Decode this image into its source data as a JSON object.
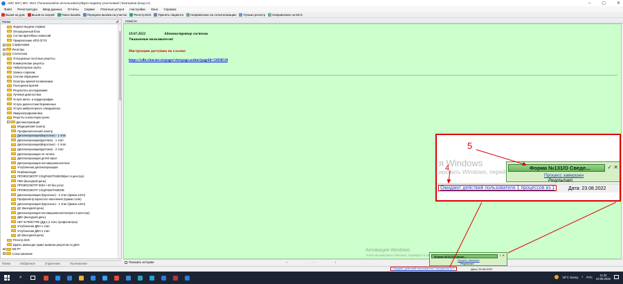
{
  "window": {
    "title": "АИС МО | МО: 2621 (Талнахская/не использовать)/Врач-педиатр участковый | Екатерина (вход от)",
    "controls": [
      "–",
      "▢",
      "✕"
    ]
  },
  "menu": [
    "Файл",
    "Регистратура",
    "Ввод данных",
    "Отчеты",
    "Сервис",
    "Платные услуги",
    "Настройки",
    "Окно",
    "Справка"
  ],
  "toolbar": [
    {
      "label": "Вызов на дом",
      "icon": "house-icon",
      "color": "#d33"
    },
    {
      "label": "Вызов из скорой",
      "icon": "ambulance-icon",
      "color": "#c33"
    },
    {
      "label": "Поиск вызова",
      "icon": "search-icon",
      "color": "#3a7"
    },
    {
      "label": "Передача вызова на участок",
      "icon": "transfer-icon",
      "color": "#58c"
    },
    {
      "label": "Регистр БСК",
      "icon": "register-icon",
      "color": "#2a8"
    },
    {
      "label": "Принять пациента",
      "icon": "patient-icon",
      "color": "#68a"
    },
    {
      "label": "Направление на госпитализацию",
      "icon": "referral-icon",
      "color": "#7a7"
    },
    {
      "label": "Пульмо регистр",
      "icon": "lungs-icon",
      "color": "#69c"
    },
    {
      "label": "Направление на МСЭ",
      "icon": "mse-icon",
      "color": "#7a9"
    }
  ],
  "left_panel": {
    "header": "Папки",
    "pin": "📌",
    "tree": [
      {
        "label": "Журнал выдачи справок",
        "depth": 2
      },
      {
        "label": "Операционный блок",
        "depth": 2
      },
      {
        "label": "Состав врачебных комиссий",
        "depth": 2
      },
      {
        "label": "Прикрепление ИПЗ ОГУЗ",
        "depth": 2
      },
      {
        "label": "Справочники",
        "depth": 1,
        "toggle": "+"
      },
      {
        "label": "Регистры",
        "depth": 1,
        "toggle": "+"
      },
      {
        "label": "Статистика",
        "depth": 1,
        "toggle": "−"
      },
      {
        "label": "Отпущенные льготные рецепты",
        "depth": 2
      },
      {
        "label": "Коммерческие рецепты",
        "depth": 2
      },
      {
        "label": "Амбулаторные карты",
        "depth": 2
      },
      {
        "label": "Записи к врачам",
        "depth": 2
      },
      {
        "label": "Случаи обращения",
        "depth": 2
      },
      {
        "label": "Осмотры врачей поликлиники",
        "depth": 2
      },
      {
        "label": "Посещения врачей",
        "depth": 2
      },
      {
        "label": "Результаты исследования",
        "depth": 2
      },
      {
        "label": "Лучевая диагностика",
        "depth": 2
      },
      {
        "label": "Услуги автно- и кардиографии",
        "depth": 2
      },
      {
        "label": "Услуги диагностики беременных",
        "depth": 2
      },
      {
        "label": "Услуги амбулаторного гемодиализа",
        "depth": 2
      },
      {
        "label": "Иммунопрофилактика",
        "depth": 2
      },
      {
        "label": "Рецепты в молочную кухню",
        "depth": 2
      },
      {
        "label": "Диспансеризация",
        "depth": 2,
        "toggle": "−"
      },
      {
        "label": "Медицинский осмотр",
        "depth": 3
      },
      {
        "label": "Профилактический осмотр",
        "depth": 3
      },
      {
        "label": "Диспансеризация(взрослые) - 1 этап",
        "depth": 3,
        "selected": true
      },
      {
        "label": "Диспансеризация(детские) - 1 этап",
        "depth": 3
      },
      {
        "label": "Диспансеризация(взрослые) - 2 этап",
        "depth": 3
      },
      {
        "label": "Диспансеризация(детские) - 2 этап",
        "depth": 3
      },
      {
        "label": "Диспансеризация 14 летних",
        "depth": 3
      },
      {
        "label": "Диспансеризация детей сирот",
        "depth": 3
      },
      {
        "label": "Диспансеризация несовершеннолетних",
        "depth": 3
      },
      {
        "label": "Углубленная диспансеризация",
        "depth": 3
      },
      {
        "label": "Реабилитация",
        "depth": 3
      },
      {
        "label": "ПРОФОСМОТР СОЦРАБОТНИКОВ(нет в реестре)",
        "depth": 3
      },
      {
        "label": "ПВН (выходной день)",
        "depth": 3
      },
      {
        "label": "ПРОФОСМОТР ЖЕН +40 без услуг",
        "depth": 3
      },
      {
        "label": "ПРОФОСМОТР СОЦРАБОТНИКОВ",
        "depth": 3
      },
      {
        "label": "Диспансеризация (взрослые) - 2 этап (приказ 124н)",
        "depth": 3
      },
      {
        "label": "Профосмотр взрослого населения (приказ 124н)",
        "depth": 3
      },
      {
        "label": "Диспансеризация (взрослые) - 1 этап (приказ 124н)",
        "depth": 3
      },
      {
        "label": "ДС (выходной день)",
        "depth": 3
      },
      {
        "label": "Диспансеризация несовершеннолетних(нет в реестре)",
        "depth": 3
      },
      {
        "label": "ДВН (выходной день)",
        "depth": 3
      },
      {
        "label": "НЕТ В РЕЕСТРЕ (ДД-1,2 этап; профосмотры)",
        "depth": 3
      },
      {
        "label": "Углубленная ДВН 1 этап",
        "depth": 3
      },
      {
        "label": "Углубленная ДВН 2 этап",
        "depth": 3
      },
      {
        "label": "ДН (выходной день)",
        "depth": 3
      },
      {
        "label": "Регистр БСК",
        "depth": 2
      },
      {
        "label": "Врачи, имеющие право выписки рецептов по ДЛО",
        "depth": 2
      },
      {
        "label": "МЗ РТ",
        "depth": 1,
        "toggle": "+"
      },
      {
        "label": "Сопоставление",
        "depth": 1,
        "toggle": "+"
      }
    ],
    "tabs": [
      "Папки",
      "Избранное",
      "Отделение",
      "Полномочия"
    ]
  },
  "main": {
    "tab": "Новости",
    "news": {
      "date": "19.07.2022",
      "author": "Администратор системы",
      "greeting": "Уважаемые пользователи!",
      "instructions": "Инструкции доступны по ссылке:",
      "link": "https://wiki.vitacore.ru/pages/viewpage.action?pageId=53838518"
    },
    "show_history": "Показать историю"
  },
  "status": {
    "waiting_link": "Ожидают действий пользователя 1 процессов из 1",
    "date": "Дата: 23.08.2022"
  },
  "watermark": {
    "title": "Активация Windows",
    "subtitle": "Чтобы активировать Windows, перейдите в раздел «Параметры»."
  },
  "toast": {
    "title": "Форма №131/О Сведе...",
    "link": "Процесс завершен",
    "result": "Результат"
  },
  "zoom": {
    "watermark_title": "я Windows",
    "watermark_sub": "ировать Windows, перей",
    "marker_5": "5",
    "marker_4": "4"
  },
  "taskbar": {
    "weather": "29°C  Sunny",
    "lang": "РУС",
    "time": "11:32",
    "date": "23.08.2022",
    "apps": [
      "#e04b3a",
      "#1e90ff",
      "#2f7fd8",
      "#e2b63a",
      "#2b8de0",
      "#39a3ff",
      "#e84c3d",
      "#3b89d9",
      "#2aa2c0",
      "#26a0da",
      "#2e7bd6",
      "#b03a3a",
      "#2b7be0"
    ]
  },
  "colors": {
    "news_bg": "#ccffcc",
    "instr": "#cc0000",
    "link": "#0000ee",
    "callout": "#e00000"
  }
}
